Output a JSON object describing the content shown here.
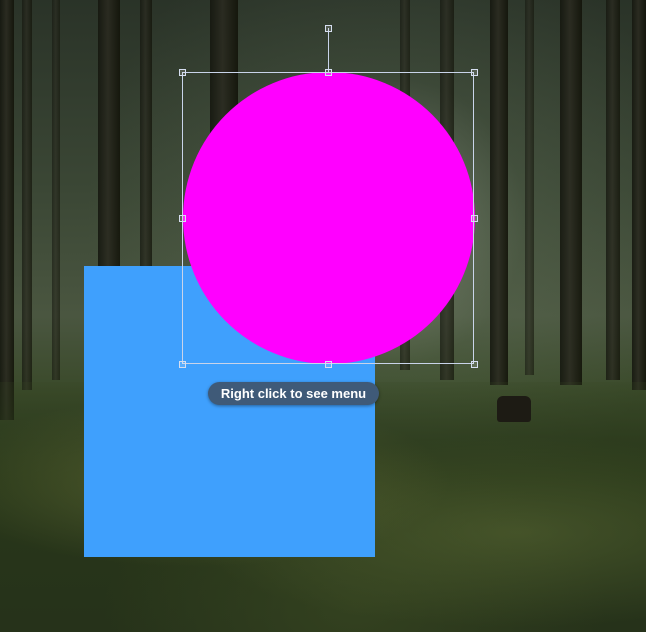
{
  "canvas": {
    "background": "forest-photo",
    "shapes": [
      {
        "kind": "square",
        "color": "#3fa0fd"
      },
      {
        "kind": "circle",
        "color": "#ff00ff",
        "selected": true
      }
    ]
  },
  "tooltip": {
    "text": "Right click to see menu"
  },
  "colors": {
    "selection_outline": "#c9d4ea",
    "tooltip_bg": "#3f5a78"
  }
}
